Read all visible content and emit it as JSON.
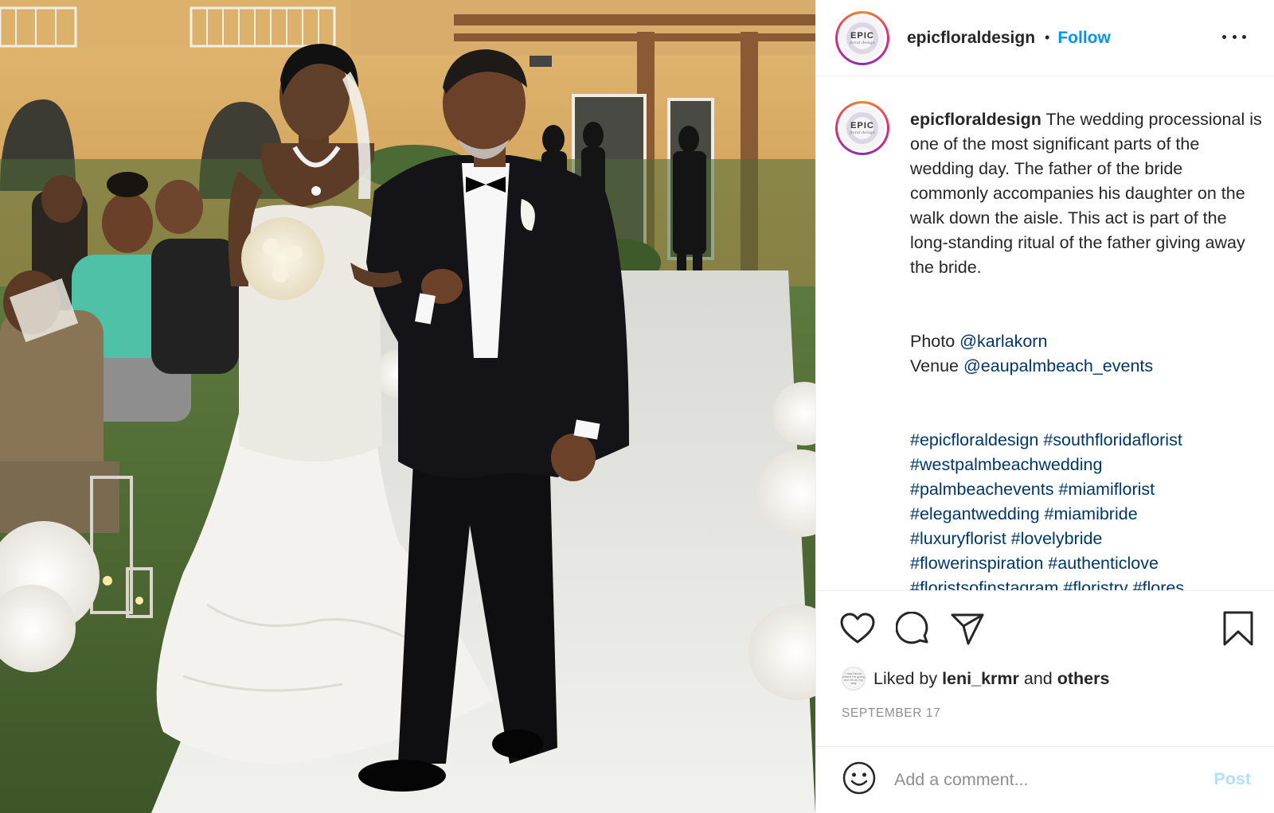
{
  "post": {
    "image_alt": "Bride walking down the aisle with her father at an outdoor wedding ceremony"
  },
  "header": {
    "avatar_text": "EPIC",
    "avatar_sub": "floral design",
    "username": "epicfloraldesign",
    "separator": "•",
    "follow_label": "Follow"
  },
  "caption": {
    "username": "epicfloraldesign",
    "text": " The wedding processional is one of the most significant parts of the wedding day. The father of the bride commonly accompanies his daughter on the walk down the aisle. This act is part of the long-standing ritual of the father giving away the bride.",
    "photo_label": "Photo ",
    "photo_link": "@karlakorn",
    "venue_label": "Venue ",
    "venue_link": "@eaupalmbeach_events",
    "hashtag_lines": [
      "#epicfloraldesign #southfloridaflorist",
      "#westpalmbeachwedding",
      "#palmbeachevents #miamiflorist",
      "#elegantwedding #miamibride",
      "#luxuryflorist #lovelybride",
      "#flowerinspiration #authenticlove",
      "#floristsofinstagram #floristry #flores"
    ]
  },
  "actions": {
    "like_icon": "heart-icon",
    "comment_icon": "comment-bubble-icon",
    "share_icon": "paper-plane-icon",
    "save_icon": "bookmark-icon"
  },
  "likes": {
    "avatar_text": "i don't know where i'm going but i'm on my way",
    "prefix": "Liked by ",
    "user": "leni_krmr",
    "middle": " and ",
    "others": "others"
  },
  "date": "SEPTEMBER 17",
  "comment": {
    "placeholder": "Add a comment...",
    "post_label": "Post"
  },
  "colors": {
    "accent": "#0095f6",
    "link": "#00376b",
    "post_disabled": "#b2dffc",
    "muted": "#8e8e8e"
  }
}
